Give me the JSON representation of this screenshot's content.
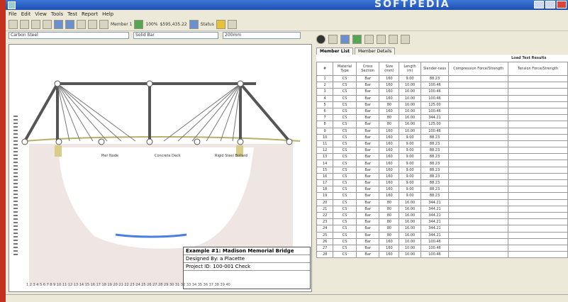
{
  "window": {
    "brand": "SOFTPEDIA"
  },
  "menu": [
    "File",
    "Edit",
    "View",
    "Tools",
    "Test",
    "Report",
    "Help"
  ],
  "toolbar": {
    "zoom_label": "Member 1",
    "percent_label": "100%",
    "cost_label": "$595,435.22",
    "status_label": "Status"
  },
  "combos": [
    "Carbon Steel",
    "Solid Bar",
    "200mm"
  ],
  "tabs": [
    "Member List",
    "Member Details"
  ],
  "table": {
    "group_header": "Load Test Results",
    "headers": [
      "#",
      "Material Type",
      "Cross Section",
      "Size (mm)",
      "Length (m)",
      "Slender-ness",
      "Compression Force/Strength",
      "Tension Force/Strength"
    ],
    "rows": [
      [
        "1",
        "CS",
        "Bar",
        "160",
        "9.00",
        "88.23"
      ],
      [
        "2",
        "CS",
        "Bar",
        "160",
        "10.00",
        "100.46"
      ],
      [
        "3",
        "CS",
        "Bar",
        "160",
        "10.00",
        "100.46"
      ],
      [
        "4",
        "CS",
        "Bar",
        "160",
        "10.00",
        "100.46"
      ],
      [
        "5",
        "CS",
        "Bar",
        "80",
        "10.00",
        "125.00"
      ],
      [
        "6",
        "CS",
        "Bar",
        "160",
        "10.00",
        "100.46"
      ],
      [
        "7",
        "CS",
        "Bar",
        "80",
        "16.00",
        "344.21"
      ],
      [
        "8",
        "CS",
        "Bar",
        "80",
        "16.00",
        "125.00"
      ],
      [
        "9",
        "CS",
        "Bar",
        "160",
        "10.00",
        "100.46"
      ],
      [
        "10",
        "CS",
        "Bar",
        "160",
        "9.00",
        "88.23"
      ],
      [
        "11",
        "CS",
        "Bar",
        "160",
        "9.00",
        "88.23"
      ],
      [
        "12",
        "CS",
        "Bar",
        "160",
        "9.00",
        "88.23"
      ],
      [
        "13",
        "CS",
        "Bar",
        "160",
        "9.00",
        "88.23"
      ],
      [
        "14",
        "CS",
        "Bar",
        "160",
        "9.00",
        "88.23"
      ],
      [
        "15",
        "CS",
        "Bar",
        "160",
        "9.00",
        "88.23"
      ],
      [
        "16",
        "CS",
        "Bar",
        "160",
        "9.00",
        "88.23"
      ],
      [
        "17",
        "CS",
        "Bar",
        "160",
        "9.00",
        "88.23"
      ],
      [
        "18",
        "CS",
        "Bar",
        "160",
        "9.00",
        "88.23"
      ],
      [
        "19",
        "CS",
        "Bar",
        "160",
        "9.00",
        "88.23"
      ],
      [
        "20",
        "CS",
        "Bar",
        "80",
        "16.00",
        "344.21"
      ],
      [
        "21",
        "CS",
        "Bar",
        "80",
        "16.00",
        "344.21"
      ],
      [
        "22",
        "CS",
        "Bar",
        "80",
        "16.00",
        "344.21"
      ],
      [
        "23",
        "CS",
        "Bar",
        "80",
        "16.00",
        "344.21"
      ],
      [
        "24",
        "CS",
        "Bar",
        "80",
        "16.00",
        "344.21"
      ],
      [
        "25",
        "CS",
        "Bar",
        "80",
        "16.00",
        "344.21"
      ],
      [
        "26",
        "CS",
        "Bar",
        "160",
        "10.00",
        "100.46"
      ],
      [
        "27",
        "CS",
        "Bar",
        "160",
        "10.00",
        "100.46"
      ],
      [
        "28",
        "CS",
        "Bar",
        "160",
        "10.00",
        "100.46"
      ]
    ]
  },
  "drawing": {
    "labels": [
      "Pier Node",
      "Concrete Deck",
      "Rigid Steel Bollard"
    ],
    "titleblock": {
      "title": "Example #1: Madison Memorial Bridge",
      "designer": "Designed By: a Placette",
      "date": "Project ID: 100-001 Check"
    },
    "ruler": "1 2 3 4 5 6 7 8 9 10 11 12 13 14 15 16 17 18 19 20 21 22 23 24 25 26 27 28 29 30 31 32 33 34 35 36 37 38 39 40"
  }
}
